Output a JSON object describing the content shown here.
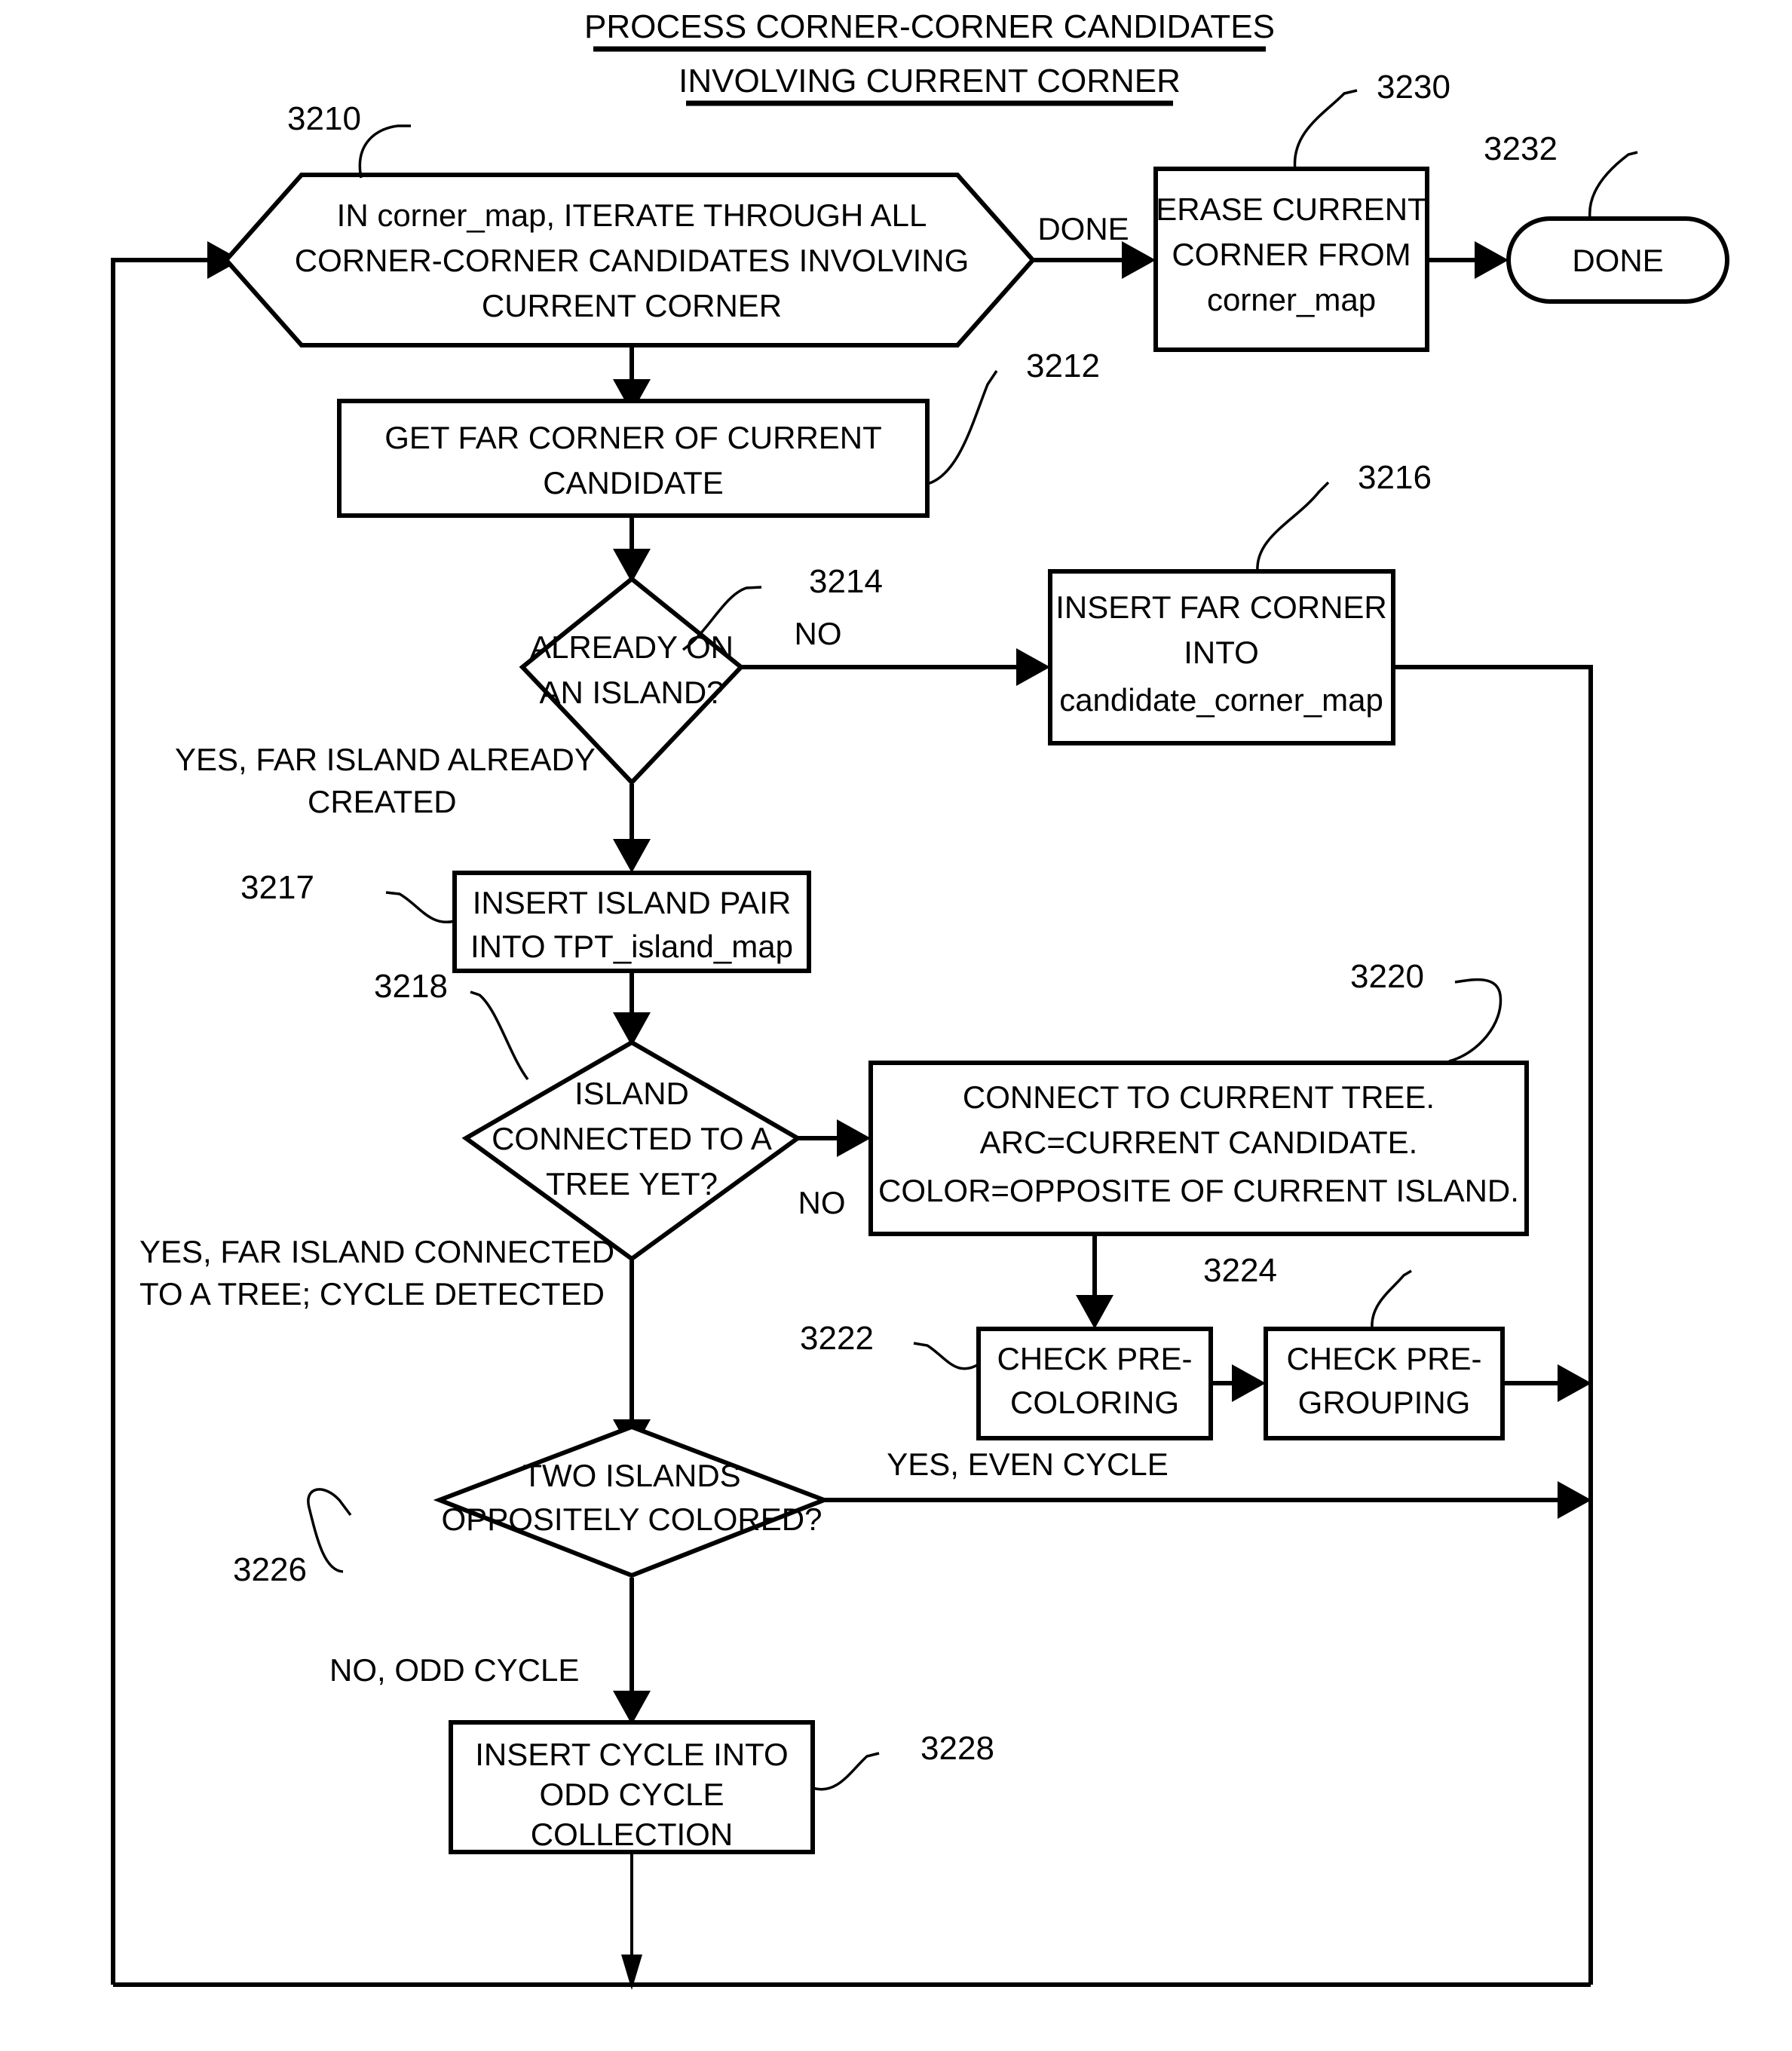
{
  "title": {
    "line1": "PROCESS CORNER-CORNER CANDIDATES",
    "line2": "INVOLVING CURRENT CORNER"
  },
  "nodes": {
    "n3210": {
      "ref": "3210",
      "shape": "hexagon",
      "lines": [
        "IN corner_map, ITERATE THROUGH ALL",
        "CORNER-CORNER CANDIDATES INVOLVING",
        "CURRENT CORNER"
      ]
    },
    "n3230": {
      "ref": "3230",
      "shape": "process",
      "lines": [
        "ERASE CURRENT",
        "CORNER FROM",
        "corner_map"
      ]
    },
    "n3232": {
      "ref": "3232",
      "shape": "terminator",
      "lines": [
        "DONE"
      ]
    },
    "n3212": {
      "ref": "3212",
      "shape": "process",
      "lines": [
        "GET FAR CORNER OF CURRENT",
        "CANDIDATE"
      ]
    },
    "n3214": {
      "ref": "3214",
      "shape": "decision",
      "lines": [
        "ALREADY ON",
        "AN ISLAND?"
      ]
    },
    "n3216": {
      "ref": "3216",
      "shape": "process",
      "lines": [
        "INSERT FAR CORNER",
        "INTO",
        "candidate_corner_map"
      ]
    },
    "n3217": {
      "ref": "3217",
      "shape": "process",
      "lines": [
        "INSERT ISLAND PAIR",
        "INTO TPT_island_map"
      ]
    },
    "n3218": {
      "ref": "3218",
      "shape": "decision",
      "lines": [
        "ISLAND",
        "CONNECTED TO A",
        "TREE YET?"
      ]
    },
    "n3220": {
      "ref": "3220",
      "shape": "process",
      "lines": [
        "CONNECT TO CURRENT TREE.",
        "ARC=CURRENT CANDIDATE.",
        "COLOR=OPPOSITE OF CURRENT ISLAND."
      ]
    },
    "n3222": {
      "ref": "3222",
      "shape": "process",
      "lines": [
        "CHECK PRE-",
        "COLORING"
      ]
    },
    "n3224": {
      "ref": "3224",
      "shape": "process",
      "lines": [
        "CHECK PRE-",
        "GROUPING"
      ]
    },
    "n3226": {
      "ref": "3226",
      "shape": "decision",
      "lines": [
        "TWO ISLANDS",
        "OPPOSITELY COLORED?"
      ]
    },
    "n3228": {
      "ref": "3228",
      "shape": "process",
      "lines": [
        "INSERT CYCLE INTO",
        "ODD CYCLE",
        "COLLECTION"
      ]
    }
  },
  "edge_labels": {
    "done_from_loop": "DONE",
    "no_already_island": "NO",
    "yes_far_island_created_l1": "YES, FAR ISLAND ALREADY",
    "yes_far_island_created_l2": "CREATED",
    "no_island_connected": "NO",
    "yes_cycle_detected_l1": "YES, FAR ISLAND CONNECTED",
    "yes_cycle_detected_l2": "TO A TREE; CYCLE DETECTED",
    "yes_even_cycle": "YES, EVEN CYCLE",
    "no_odd_cycle": "NO, ODD CYCLE"
  },
  "colors": {
    "stroke": "#000000",
    "fill": "#ffffff"
  }
}
